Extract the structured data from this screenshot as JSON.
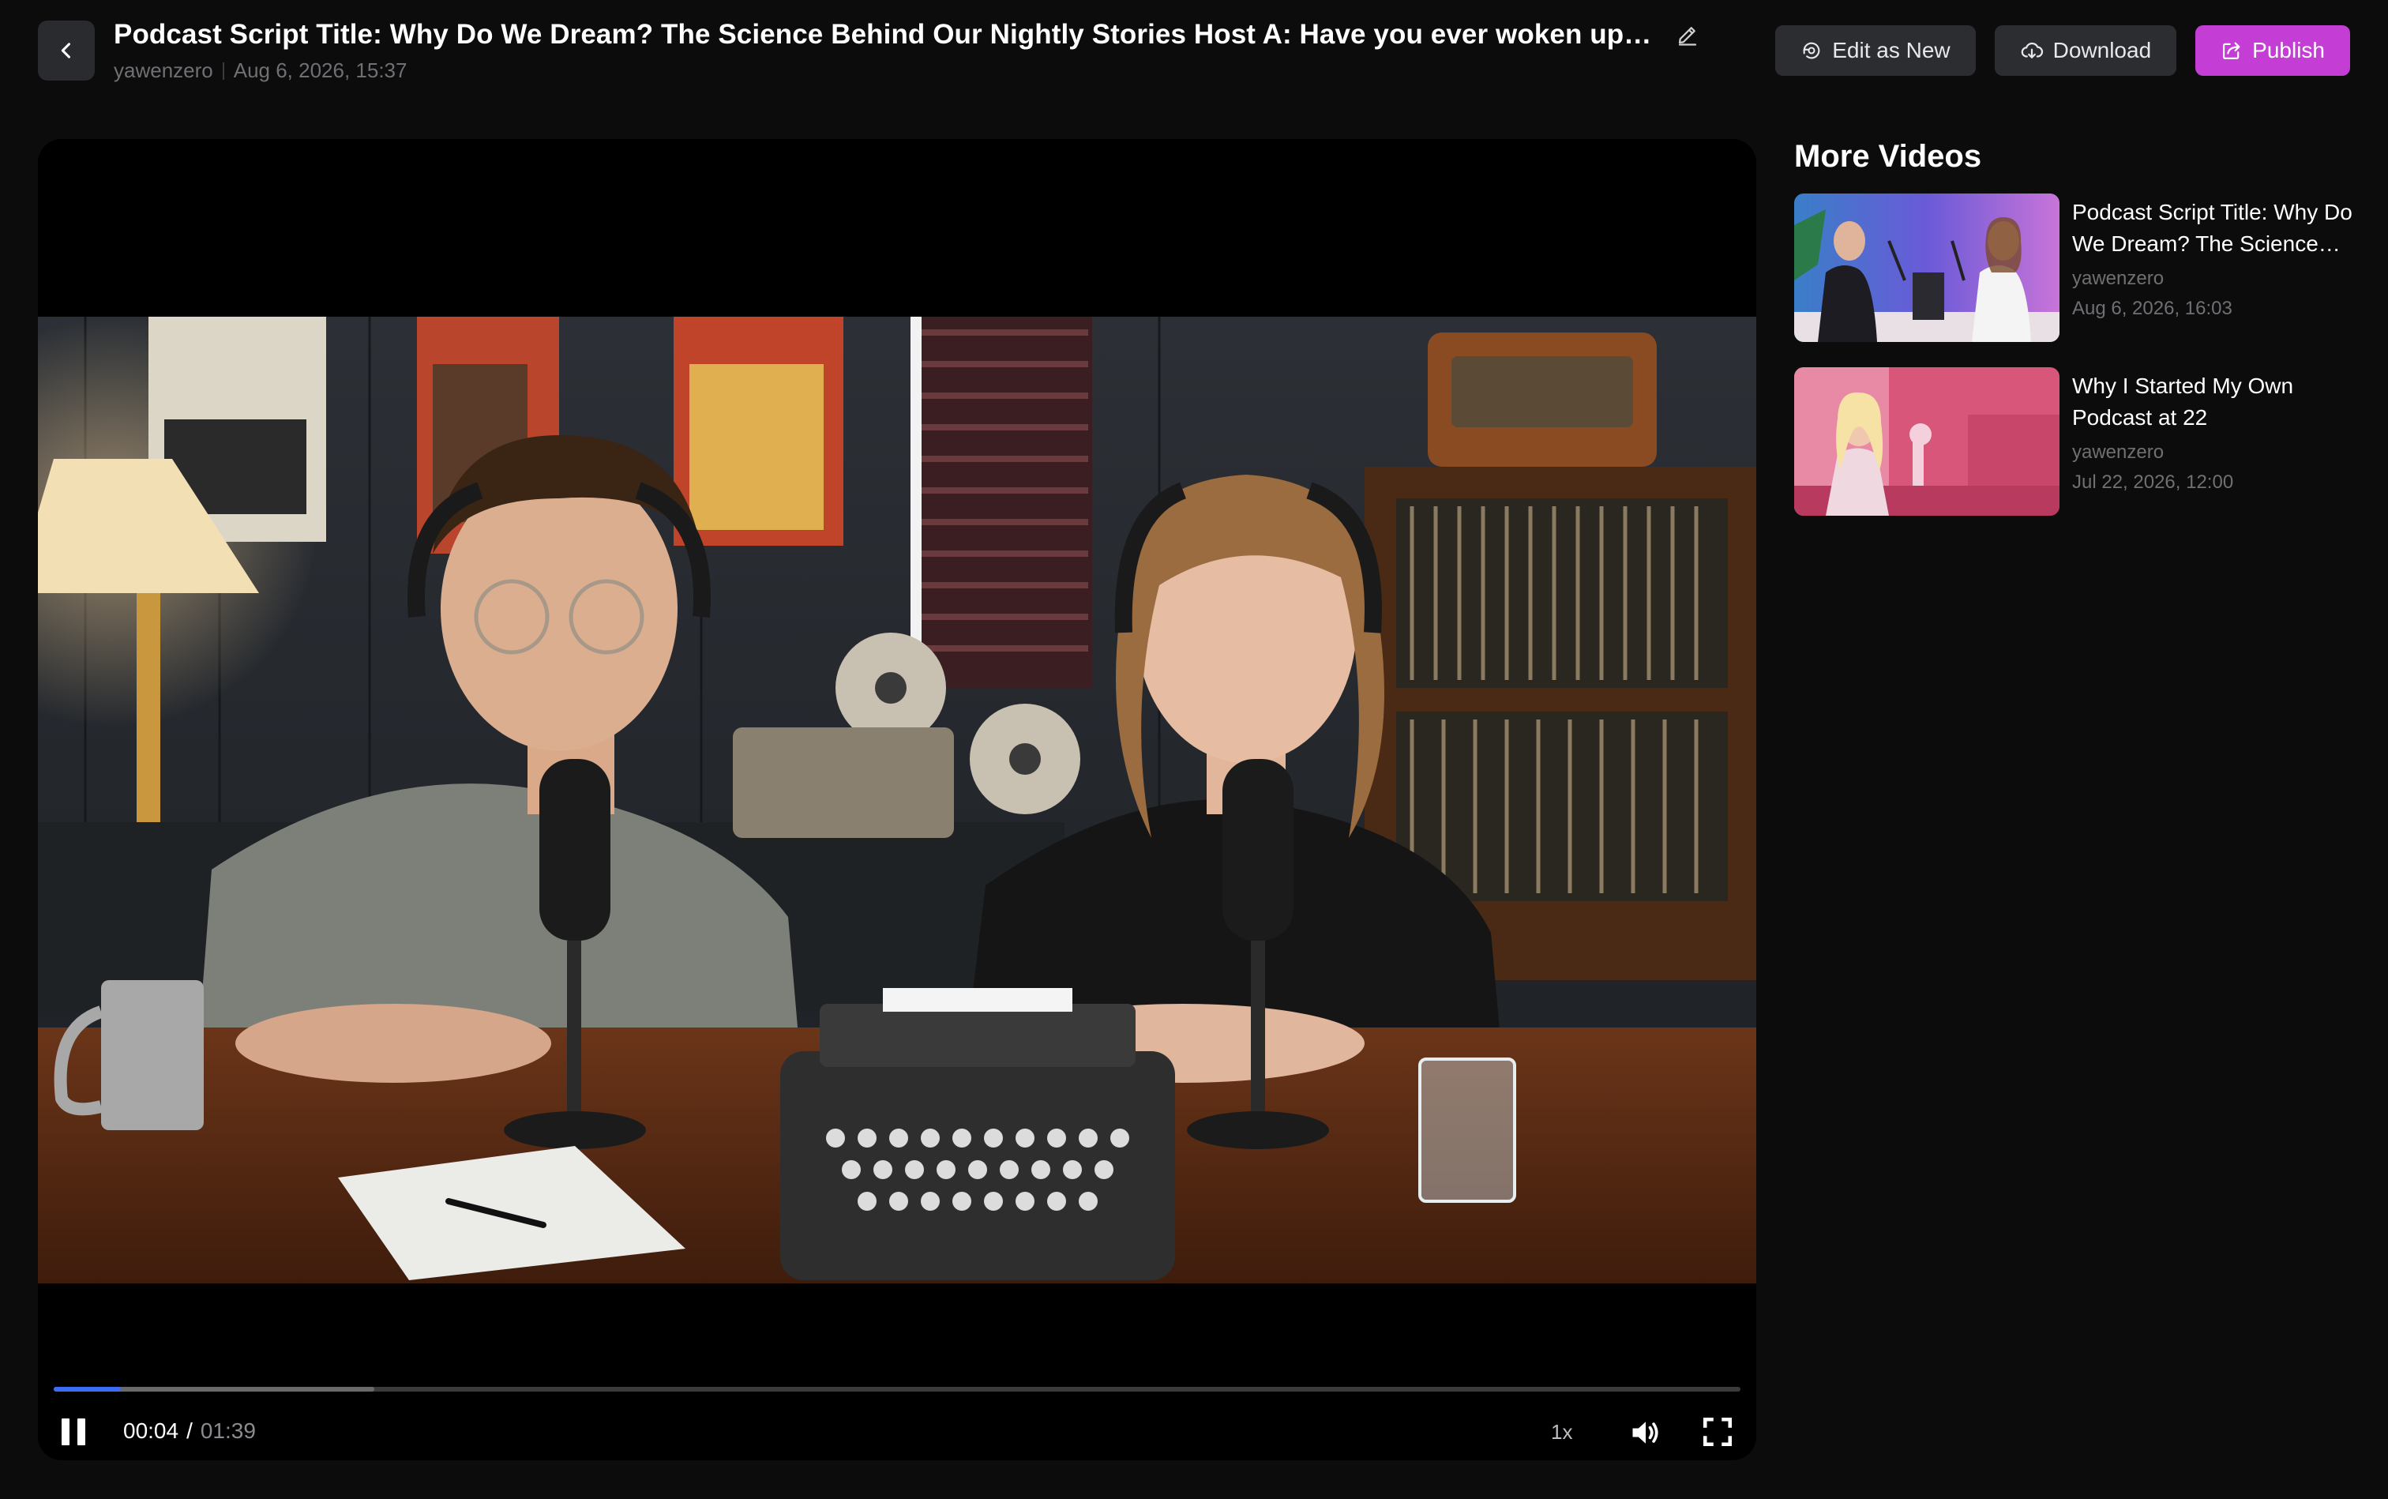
{
  "header": {
    "title": "Podcast Script Title: Why Do We Dream? The Science Behind Our Nightly Stories Host A: Have you ever woken up from a dream",
    "author": "yawenzero",
    "timestamp": "Aug 6, 2026, 15:37",
    "icons": {
      "back": "chevron-left-icon",
      "edit": "pencil-icon"
    }
  },
  "actions": {
    "edit_as_new": "Edit as New",
    "download": "Download",
    "publish": "Publish",
    "publish_color": "#c43ed6"
  },
  "player": {
    "current_time": "00:04",
    "separator": "/",
    "duration": "01:39",
    "speed": "1x",
    "played_fraction": 0.04,
    "buffered_fraction": 0.19,
    "state": "playing",
    "accent": "#3b6cf6"
  },
  "sidebar": {
    "title": "More Videos",
    "items": [
      {
        "title": "Podcast Script Title: Why Do We Dream? The Science Behind Our Nightly Stories",
        "author": "yawenzero",
        "date": "Aug 6, 2026, 16:03"
      },
      {
        "title": "Why I Started My Own Podcast at 22",
        "author": "yawenzero",
        "date": "Jul 22, 2026, 12:00"
      }
    ]
  }
}
